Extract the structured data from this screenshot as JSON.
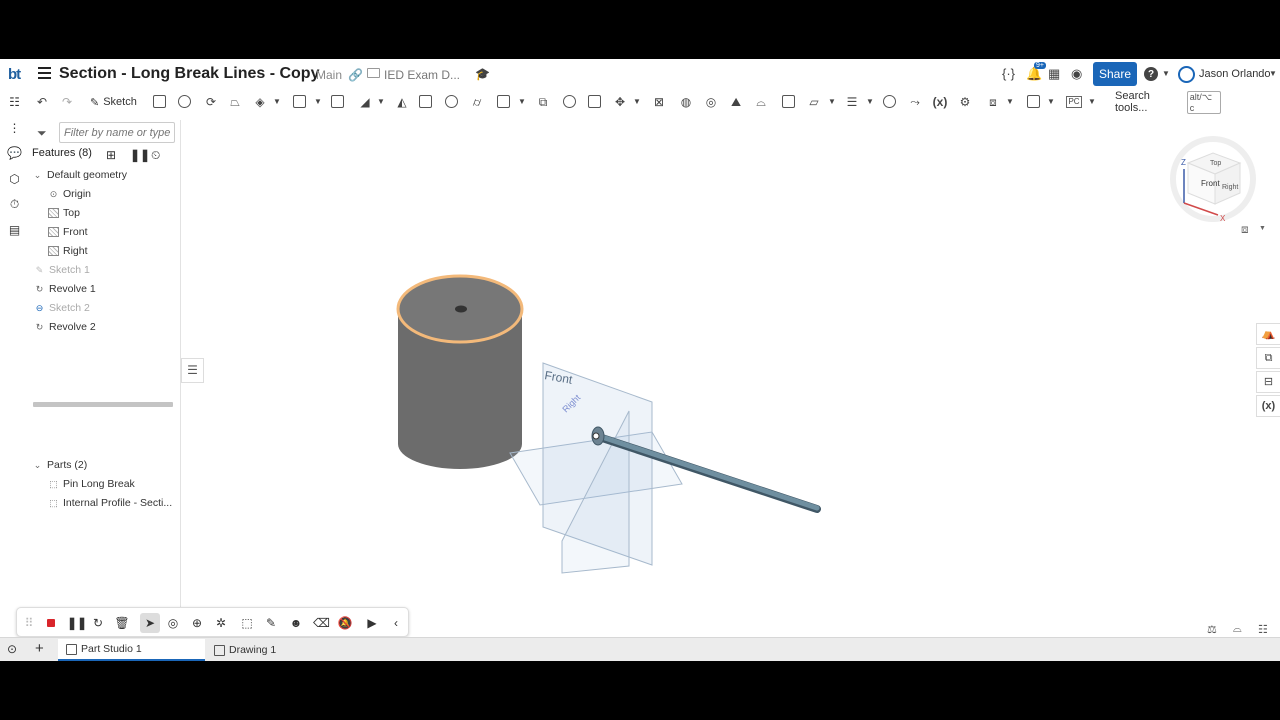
{
  "header": {
    "logo": "bt",
    "document_title": "Section - Long Break Lines - Copy",
    "branch": "Main",
    "folder": "IED Exam D...",
    "share_label": "Share",
    "help_label": "?",
    "user_name": "Jason Orlando",
    "notification_badge": "9+"
  },
  "toolbar": {
    "sketch_label": "Sketch",
    "search_label": "Search tools...",
    "search_shortcut": "alt/⌥ c",
    "variable_label": "(x)",
    "pc_label": "PC"
  },
  "features": {
    "filter_placeholder": "Filter by name or type",
    "header": "Features (8)",
    "default_geometry": "Default geometry",
    "items": [
      {
        "label": "Origin"
      },
      {
        "label": "Top"
      },
      {
        "label": "Front"
      },
      {
        "label": "Right"
      },
      {
        "label": "Sketch 1"
      },
      {
        "label": "Revolve 1"
      },
      {
        "label": "Sketch 2"
      },
      {
        "label": "Revolve 2"
      }
    ]
  },
  "parts": {
    "header": "Parts (2)",
    "items": [
      {
        "label": "Pin Long Break"
      },
      {
        "label": "Internal Profile - Secti..."
      }
    ]
  },
  "viewport": {
    "plane_front": "Front",
    "plane_right": "Right",
    "plane_top": "Top"
  },
  "viewcube": {
    "face_front": "Front",
    "face_top": "Top",
    "face_right": "Right",
    "axis_z": "Z",
    "axis_x": "X"
  },
  "tabs": [
    {
      "label": "Part Studio 1"
    },
    {
      "label": "Drawing 1"
    }
  ],
  "colors": {
    "accent": "#1a66b8",
    "rec": "#d9252b",
    "cylinder": "#6c6c6c",
    "pin": "#5f7f8f",
    "highlight": "#f3b97a"
  }
}
